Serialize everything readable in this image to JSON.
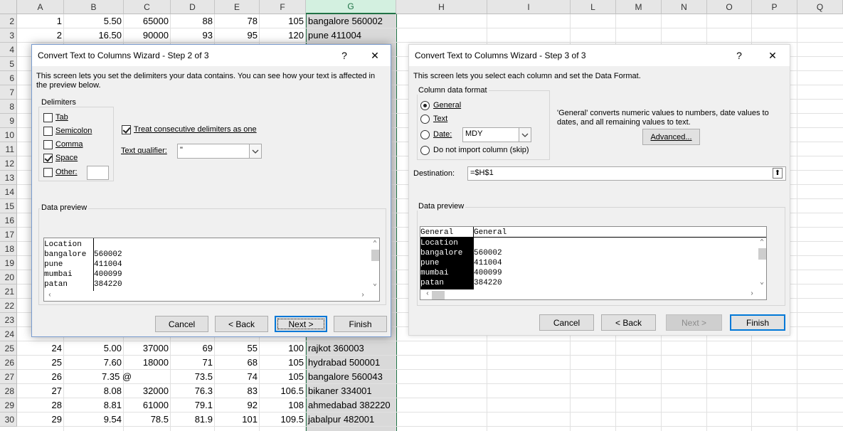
{
  "sheet": {
    "columns": [
      "A",
      "B",
      "C",
      "D",
      "E",
      "F",
      "G",
      "H",
      "I",
      "L",
      "M",
      "N",
      "O",
      "P",
      "Q"
    ],
    "selected_column": "G",
    "rows_top": [
      {
        "row": "2",
        "A": "1",
        "B": "5.50",
        "C": "65000",
        "D": "88",
        "E": "78",
        "F": "105",
        "G": "bangalore 560002"
      },
      {
        "row": "3",
        "A": "2",
        "B": "16.50",
        "C": "90000",
        "D": "93",
        "E": "95",
        "F": "120",
        "G": "pune 411004"
      }
    ],
    "hidden_row_numbers": [
      "4",
      "5",
      "6",
      "7",
      "8",
      "9",
      "10",
      "11",
      "12",
      "13",
      "14",
      "15",
      "16",
      "17",
      "18",
      "19",
      "20",
      "21",
      "22",
      "23",
      "24"
    ],
    "rows_bottom": [
      {
        "row": "25",
        "A": "24",
        "B": "5.00",
        "C": "37000",
        "D": "69",
        "E": "55",
        "F": "100",
        "G": "rajkot 360003"
      },
      {
        "row": "26",
        "A": "25",
        "B": "7.60",
        "C": "18000",
        "D": "71",
        "E": "68",
        "F": "105",
        "G": "hydrabad 500001"
      },
      {
        "row": "27",
        "A": "26",
        "B": "7.35 @",
        "C": "",
        "D": "73.5",
        "E": "74",
        "F": "105",
        "G": "bangalore 560043"
      },
      {
        "row": "28",
        "A": "27",
        "B": "8.08",
        "C": "32000",
        "D": "76.3",
        "E": "83",
        "F": "106.5",
        "G": "bikaner 334001"
      },
      {
        "row": "29",
        "A": "28",
        "B": "8.81",
        "C": "61000",
        "D": "79.1",
        "E": "92",
        "F": "108",
        "G": "ahmedabad 382220"
      },
      {
        "row": "30",
        "A": "29",
        "B": "9.54",
        "C": "78.5",
        "D": "81.9",
        "E": "101",
        "F": "109.5",
        "G": "jabalpur 482001"
      }
    ]
  },
  "step2": {
    "title": "Convert Text to Columns Wizard - Step 2 of 3",
    "help": "?",
    "close": "✕",
    "description": "This screen lets you set the delimiters your data contains.  You can see how your text is affected in the preview below.",
    "delimiters_label": "Delimiters",
    "tab": {
      "label": "Tab",
      "checked": false
    },
    "semicolon": {
      "label": "Semicolon",
      "checked": false
    },
    "comma": {
      "label": "Comma",
      "checked": false
    },
    "space": {
      "label": "Space",
      "checked": true
    },
    "other": {
      "label": "Other:",
      "checked": false,
      "value": ""
    },
    "consecutive": {
      "label": "Treat consecutive delimiters as one",
      "checked": true
    },
    "qualifier_label": "Text qualifier:",
    "qualifier_value": "\"",
    "preview_label": "Data preview",
    "preview_col1": [
      "Location",
      "bangalore",
      "pune",
      "mumbai",
      "patan"
    ],
    "preview_col2": [
      "",
      "560002",
      "411004",
      "400099",
      "384220"
    ],
    "buttons": {
      "cancel": "Cancel",
      "back": "< Back",
      "next": "Next >",
      "finish": "Finish"
    }
  },
  "step3": {
    "title": "Convert Text to Columns Wizard - Step 3 of 3",
    "help": "?",
    "close": "✕",
    "description": "This screen lets you select each column and set the Data Format.",
    "format_label": "Column data format",
    "general": {
      "label": "General",
      "selected": true
    },
    "text": {
      "label": "Text",
      "selected": false
    },
    "date": {
      "label": "Date:",
      "selected": false,
      "value": "MDY"
    },
    "skip": {
      "label": "Do not import column (skip)",
      "selected": false
    },
    "info": "'General' converts numeric values to numbers, date values to dates, and all remaining values to text.",
    "advanced": "Advanced...",
    "destination_label": "Destination:",
    "destination_value": "=$H$1",
    "preview_label": "Data preview",
    "preview_headers": [
      "General",
      "General"
    ],
    "preview_col1": [
      "Location",
      "bangalore",
      "pune",
      "mumbai",
      "patan"
    ],
    "preview_col2": [
      "",
      "560002",
      "411004",
      "400099",
      "384220"
    ],
    "buttons": {
      "cancel": "Cancel",
      "back": "< Back",
      "next": "Next >",
      "finish": "Finish"
    }
  }
}
